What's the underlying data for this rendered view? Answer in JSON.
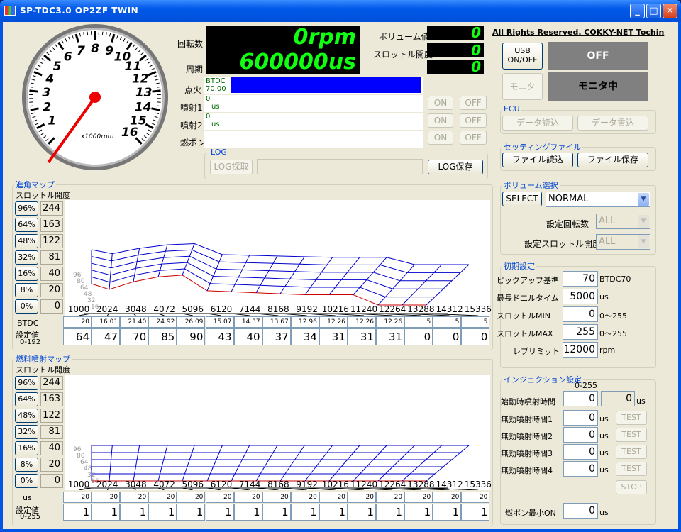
{
  "window": {
    "title": "SP-TDC3.0 OP2ZF TWIN",
    "minimize": "_",
    "maximize": "□",
    "close": "✕"
  },
  "copyright": "All Rights Reserved. COKKY-NET Tochin",
  "gauge": {
    "unit": "x1000rpm",
    "ticks": [
      "1",
      "2",
      "3",
      "4",
      "5",
      "6",
      "7",
      "8",
      "9",
      "10",
      "11",
      "12",
      "13",
      "14",
      "15",
      "16"
    ],
    "needle_value": 0
  },
  "readouts": {
    "rpm_label": "回転数",
    "rpm_value": "0rpm",
    "period_label": "周期",
    "period_value": "600000us",
    "volume_label": "ボリューム値",
    "volume_value": "0",
    "throttle_label": "スロットル開度",
    "throttle_value1": "0",
    "throttle_value2": "0"
  },
  "ignition": {
    "label": "点火",
    "btdc": "BTDC",
    "value": "70.00",
    "bar_color": "#0000ff",
    "bar_fill": 1.0
  },
  "inj1": {
    "label": "噴射1",
    "value": "0",
    "unit": "us",
    "on": "ON",
    "off": "OFF"
  },
  "inj2": {
    "label": "噴射2",
    "value": "0",
    "unit": "us",
    "on": "ON",
    "off": "OFF"
  },
  "pump": {
    "label": "燃ポン",
    "on": "ON",
    "off": "OFF"
  },
  "log": {
    "title": "LOG",
    "capture": "LOG採取",
    "save": "LOG保存",
    "path": ""
  },
  "usb": {
    "button": "USB\nON/OFF",
    "status": "OFF"
  },
  "monitor": {
    "button": "モニタ",
    "status": "モニタ中"
  },
  "ecu": {
    "title": "ECU",
    "read": "データ読込",
    "write": "データ書込"
  },
  "setting_file": {
    "title": "セッティングファイル",
    "read": "ファイル読込",
    "save": "ファイル保存"
  },
  "volume_select": {
    "title": "ボリューム選択",
    "select": "SELECT",
    "mode": "NORMAL",
    "rpm_label": "設定回転数",
    "rpm_value": "ALL",
    "throttle_label": "設定スロットル開度",
    "throttle_value": "ALL"
  },
  "initial": {
    "title": "初期設定",
    "rows": [
      {
        "label": "ピックアップ基準",
        "value": "70",
        "unit": "BTDC70"
      },
      {
        "label": "最長ドエルタイム",
        "value": "5000",
        "unit": "us"
      },
      {
        "label": "スロットルMIN",
        "value": "0",
        "unit": "0～255"
      },
      {
        "label": "スロットルMAX",
        "value": "255",
        "unit": "0～255"
      },
      {
        "label": "レブリミット",
        "value": "12000",
        "unit": "rpm"
      }
    ]
  },
  "injection": {
    "title": "インジェクション設定",
    "range": "0-255",
    "start_label": "始動時噴射時間",
    "start_value": "0",
    "start_value2": "0",
    "start_unit": "us",
    "test": "TEST",
    "stop": "STOP",
    "rows": [
      {
        "label": "無効噴射時間1",
        "value": "0",
        "unit": "us"
      },
      {
        "label": "無効噴射時間2",
        "value": "0",
        "unit": "us"
      },
      {
        "label": "無効噴射時間3",
        "value": "0",
        "unit": "us"
      },
      {
        "label": "無効噴射時間4",
        "value": "0",
        "unit": "us"
      }
    ],
    "pump_min_label": "燃ポン最小ON",
    "pump_min_value": "0",
    "pump_min_unit": "us"
  },
  "advance_map": {
    "title": "進角マップ",
    "subtitle": "スロットル開度",
    "throttle_buttons": [
      "96%",
      "64%",
      "48%",
      "32%",
      "16%",
      "8%",
      "0%"
    ],
    "throttle_values": [
      "244",
      "163",
      "122",
      "81",
      "40",
      "20",
      "0"
    ],
    "row_label": "BTDC",
    "set_label": "設定値",
    "set_range": "0-192",
    "btdc": [
      "20",
      "16.01",
      "21.40",
      "24.92",
      "26.09",
      "15.07",
      "14.37",
      "13.67",
      "12.96",
      "12.26",
      "12.26",
      "12.26",
      "5",
      "5",
      "5"
    ],
    "settings": [
      "64",
      "47",
      "70",
      "85",
      "90",
      "43",
      "40",
      "37",
      "34",
      "31",
      "31",
      "31",
      "0",
      "0",
      "0"
    ]
  },
  "fuel_map": {
    "title": "燃料噴射マップ",
    "subtitle": "スロットル開度",
    "throttle_buttons": [
      "96%",
      "64%",
      "48%",
      "32%",
      "16%",
      "8%",
      "0%"
    ],
    "throttle_values": [
      "244",
      "163",
      "122",
      "81",
      "40",
      "20",
      "0"
    ],
    "row_label": "us",
    "set_label": "設定値",
    "set_range": "0-255",
    "us": [
      "20",
      "20",
      "20",
      "20",
      "20",
      "20",
      "20",
      "20",
      "20",
      "20",
      "20",
      "20",
      "20",
      "20",
      "20"
    ],
    "settings": [
      "1",
      "1",
      "1",
      "1",
      "1",
      "1",
      "1",
      "1",
      "1",
      "1",
      "1",
      "1",
      "1",
      "1",
      "1"
    ]
  },
  "chart_data": [
    {
      "type": "surface",
      "title": "進角マップ",
      "x": [
        1000,
        2024,
        3048,
        4072,
        5096,
        6120,
        7144,
        8168,
        9192,
        10216,
        11240,
        12264,
        13288,
        14312,
        15336
      ],
      "y_labels": [
        "96",
        "80",
        "64",
        "48",
        "32",
        "16"
      ],
      "series": [
        {
          "values": [
            20,
            16.01,
            21.4,
            24.92,
            26.09,
            15.07,
            14.37,
            13.67,
            12.96,
            12.26,
            12.26,
            12.26,
            5,
            5,
            5
          ]
        }
      ]
    },
    {
      "type": "surface",
      "title": "燃料噴射マップ",
      "x": [
        1000,
        2024,
        3048,
        4072,
        5096,
        6120,
        7144,
        8168,
        9192,
        10216,
        11240,
        12264,
        13288,
        14312,
        15336
      ],
      "y_labels": [
        "96",
        "80",
        "64",
        "48",
        "32",
        "16"
      ],
      "series": [
        {
          "values": [
            20,
            20,
            20,
            20,
            20,
            20,
            20,
            20,
            20,
            20,
            20,
            20,
            20,
            20,
            20
          ]
        }
      ]
    }
  ],
  "colors": {
    "led_text": "#11ff11",
    "grid_blue": "#0000cc",
    "front_red": "#cc0000",
    "status_gray": "#808080"
  }
}
